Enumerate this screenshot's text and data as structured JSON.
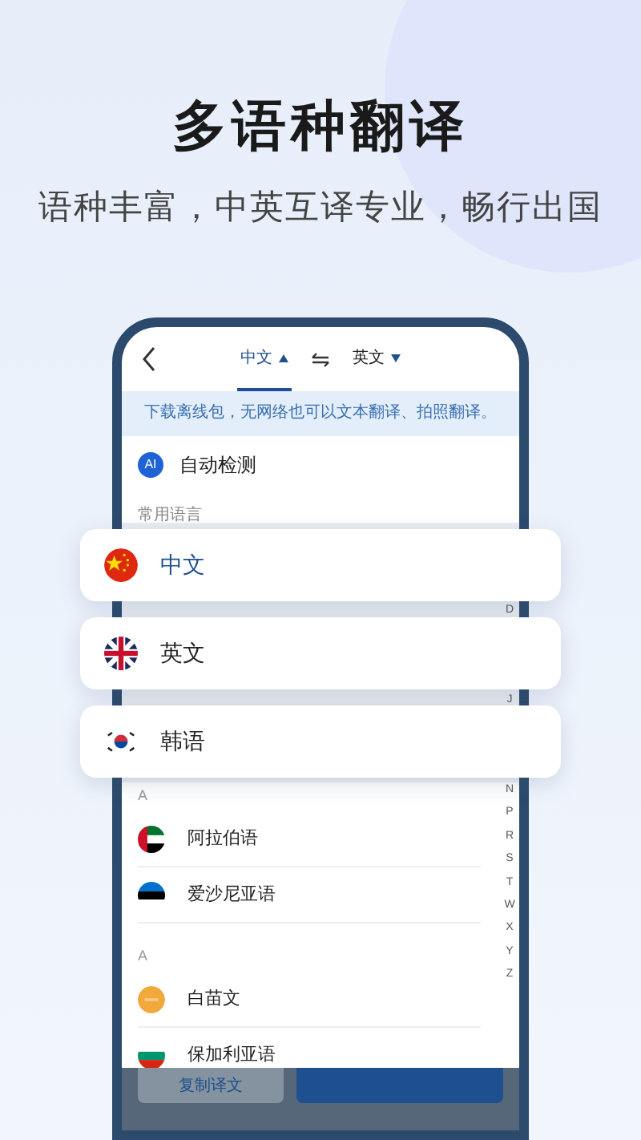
{
  "headline": "多语种翻译",
  "subheadline": "语种丰富，中英互译专业，畅行出国",
  "phone": {
    "tabs": [
      {
        "label": "中文",
        "selected": true,
        "kind": "up"
      },
      {
        "label": "英文",
        "selected": false,
        "kind": "down"
      }
    ],
    "notice": "下载离线包，无网络也可以文本翻译、拍照翻译。",
    "auto_detect": {
      "badge": "AI",
      "label": "自动检测"
    },
    "section_label": "常用语言",
    "index_letters": [
      "D",
      "J",
      "N",
      "P",
      "R",
      "S",
      "T",
      "W",
      "X",
      "Y",
      "Z"
    ],
    "list_groups": [
      {
        "letter": "A",
        "items": [
          {
            "name": "阿拉伯语",
            "kind": "uae"
          },
          {
            "name": "爱沙尼亚语",
            "kind": "estonia"
          }
        ]
      },
      {
        "letter": "A",
        "items": [
          {
            "name": "白苗文",
            "kind": "hmong"
          },
          {
            "name": "保加利亚语",
            "kind": "bulgaria"
          }
        ]
      }
    ],
    "buttons": [
      {
        "label": "复制译文",
        "kind": "secondary"
      },
      {
        "kind": "primary"
      }
    ]
  },
  "popular_cards": [
    {
      "name": "中文",
      "kind": "china",
      "selected": true
    },
    {
      "name": "英文",
      "kind": "uk",
      "selected": false
    },
    {
      "name": "韩语",
      "kind": "korea",
      "selected": false
    }
  ]
}
